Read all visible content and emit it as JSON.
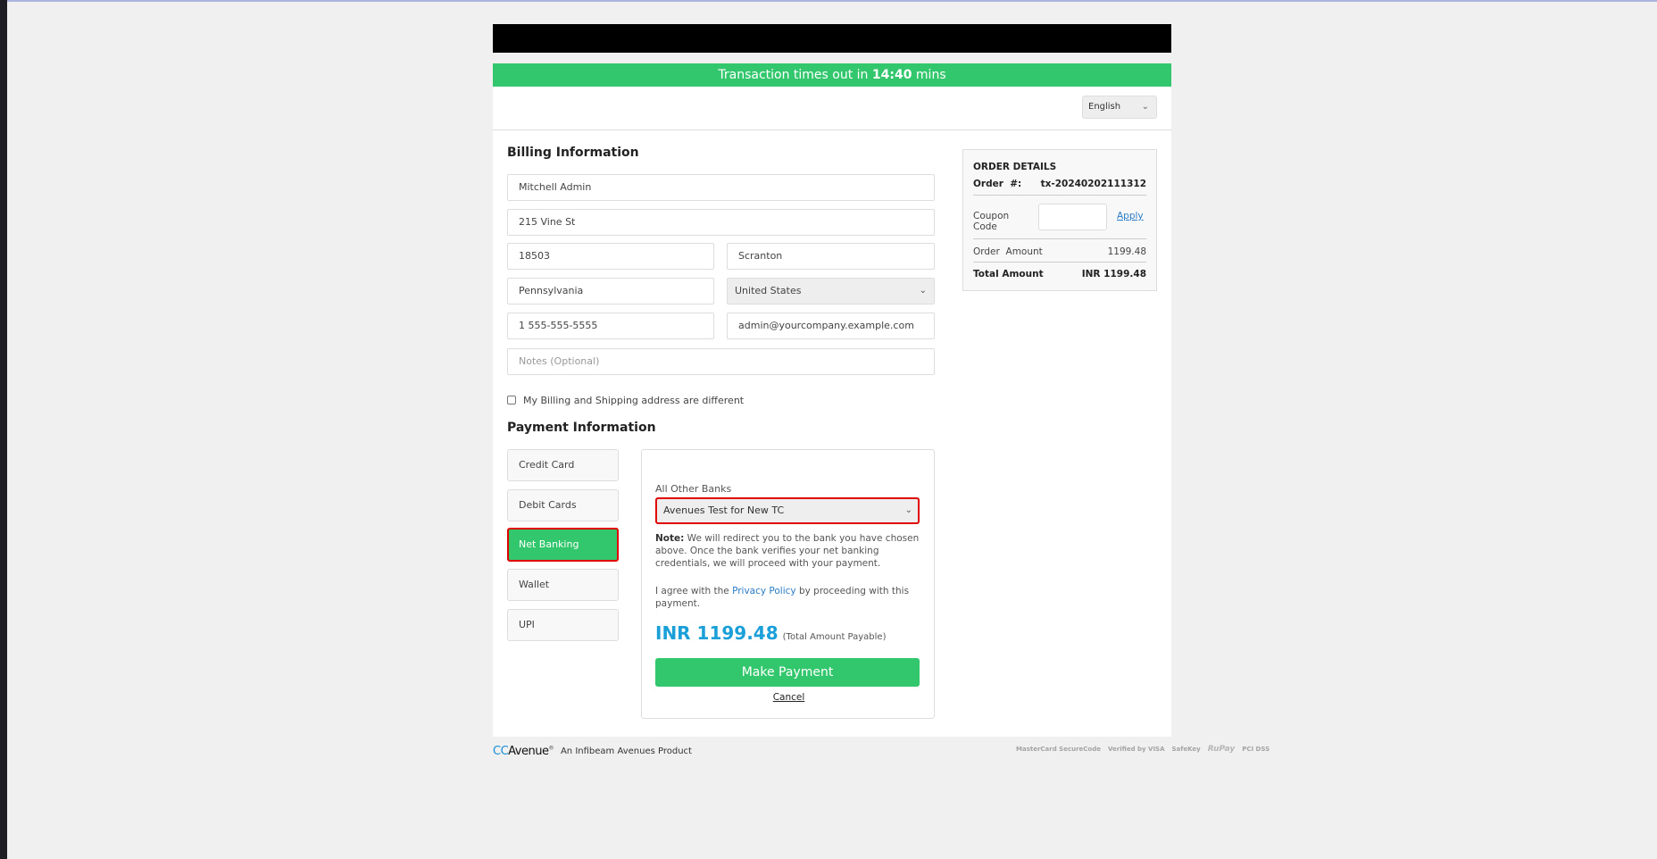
{
  "timer": {
    "prefix": "Transaction times out in",
    "time": "14:40",
    "suffix": "mins"
  },
  "language": {
    "selected": "English"
  },
  "billing": {
    "title": "Billing Information",
    "name": "Mitchell Admin",
    "address": "215 Vine St",
    "zip": "18503",
    "city": "Scranton",
    "state": "Pennsylvania",
    "country": "United States",
    "phone": "1 555-555-5555",
    "email": "admin@yourcompany.example.com",
    "notes_placeholder": "Notes (Optional)",
    "different_address_label": "My Billing and Shipping address are different",
    "different_address_checked": false
  },
  "payment": {
    "title": "Payment Information",
    "tabs": [
      {
        "label": "Credit Card",
        "active": false
      },
      {
        "label": "Debit Cards",
        "active": false
      },
      {
        "label": "Net Banking",
        "active": true
      },
      {
        "label": "Wallet",
        "active": false
      },
      {
        "label": "UPI",
        "active": false
      }
    ],
    "net_banking": {
      "bank_label": "All Other Banks",
      "bank_selected": "Avenues Test for New TC",
      "note_bold": "Note:",
      "note_text": " We will redirect you to the bank you have chosen above. Once the bank verifies your net banking credentials, we will proceed with your payment.",
      "agree_prefix": "I agree with the ",
      "agree_link": "Privacy Policy",
      "agree_suffix": " by proceeding with this payment.",
      "amount": "INR 1199.48",
      "amount_caption": "(Total Amount Payable)",
      "make_payment_label": "Make Payment",
      "cancel_label": "Cancel"
    }
  },
  "order": {
    "title": "ORDER DETAILS",
    "order_no_label": "Order  #:",
    "order_no": "tx-20240202111312",
    "coupon_label": "Coupon Code",
    "coupon_value": "",
    "apply_label": "Apply",
    "order_amount_label": "Order  Amount",
    "order_amount": "1199.48",
    "total_label": "Total Amount",
    "total": "INR 1199.48"
  },
  "footer": {
    "brand_cc": "CC",
    "brand_avenue": "Avenue",
    "brand_reg": "®",
    "tagline": "An Infibeam Avenues Product",
    "trust_logos": [
      "MasterCard SecureCode",
      "Verified by VISA",
      "SafeKey",
      "RuPay",
      "PCI DSS"
    ]
  },
  "colors": {
    "accent_green": "#33c76d",
    "amount_blue": "#1a9fd8",
    "link_blue": "#2a7bc4",
    "selected_border_red": "#e00000"
  }
}
